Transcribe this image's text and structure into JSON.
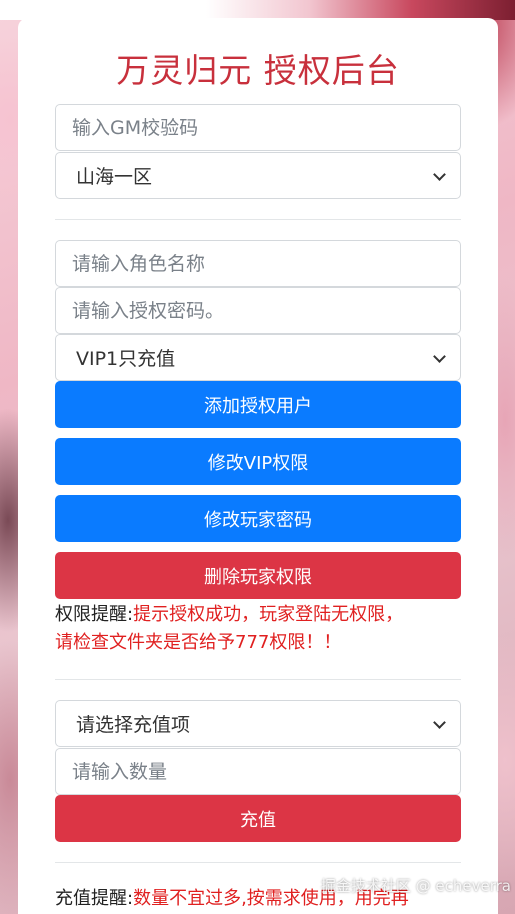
{
  "page": {
    "title": "万灵归元 授权后台",
    "watermark": "掘金技术社区 @ echeverra"
  },
  "server_section": {
    "gm_code_placeholder": "输入GM校验码",
    "server_select_value": "山海一区"
  },
  "auth_section": {
    "role_name_placeholder": "请输入角色名称",
    "auth_password_placeholder": "请输入授权密码。",
    "vip_select_value": "VIP1只充值",
    "buttons": {
      "add_auth_user": "添加授权用户",
      "modify_vip": "修改VIP权限",
      "modify_password": "修改玩家密码",
      "delete_permission": "删除玩家权限"
    },
    "notice_label": "权限提醒:",
    "notice_text_line1": "提示授权成功，玩家登陆无权限，",
    "notice_text_line2": "请检查文件夹是否给予777权限！！"
  },
  "recharge_section": {
    "item_select_value": "请选择充值项",
    "quantity_placeholder": "请输入数量",
    "recharge_button": "充值",
    "notice_label": "充值提醒:",
    "notice_text": "数量不宜过多,按需求使用，用完再"
  },
  "colors": {
    "title": "#c8303c",
    "primary_button": "#0a7bff",
    "danger_button": "#dc3545",
    "notice_highlight": "#e02020"
  }
}
